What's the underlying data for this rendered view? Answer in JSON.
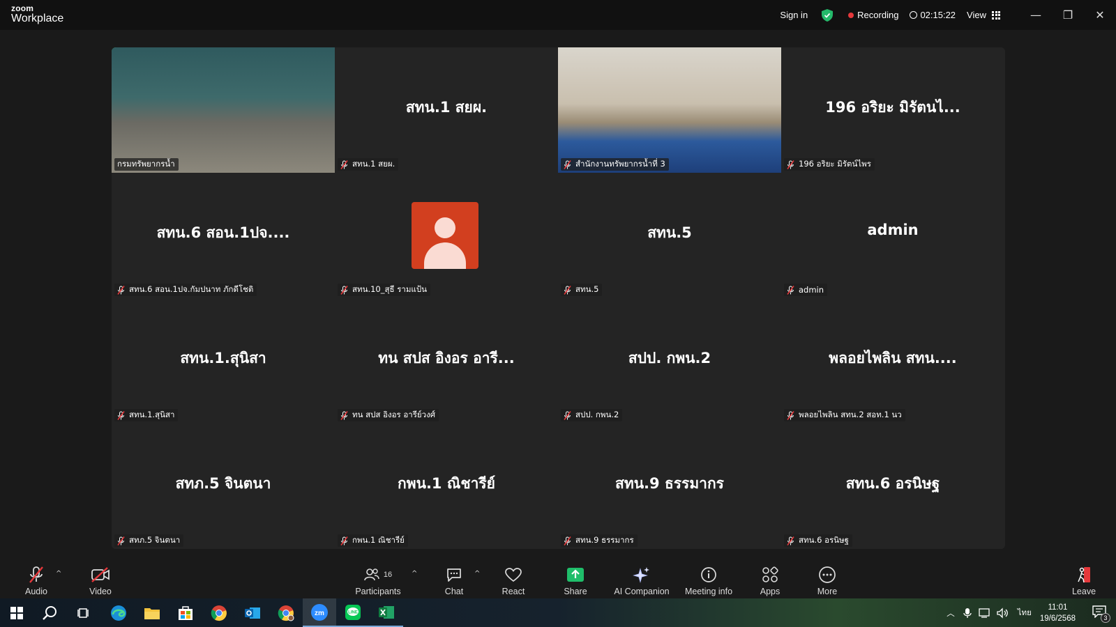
{
  "app": {
    "brand_small": "zoom",
    "brand_large": "Workplace"
  },
  "titlebar": {
    "sign_in": "Sign in",
    "recording": "Recording",
    "timer": "02:15:22",
    "view": "View"
  },
  "colors": {
    "active_speaker": "#3cd07a",
    "recording": "#e5383b",
    "avatar": "#d23f1f",
    "share": "#1fbe6a"
  },
  "tiles": [
    {
      "kind": "video",
      "big": "",
      "label": "กรมทรัพยากรน้ำ",
      "muted": false
    },
    {
      "kind": "name",
      "big": "สทน.1 สยผ.",
      "label": "สทน.1 สยผ.",
      "muted": true
    },
    {
      "kind": "video",
      "big": "",
      "label": "สำนักงานทรัพยากรน้ำที่ 3",
      "muted": true
    },
    {
      "kind": "name",
      "big": "196 อริยะ มิรัตนไ...",
      "label": "196 อริยะ มิรัตน์ไพร",
      "muted": true
    },
    {
      "kind": "name",
      "big": "สทน.6 สอน.1ปจ....",
      "label": "สทน.6 สอน.1ปจ.กัมปนาท ภักดีโชติ",
      "muted": true
    },
    {
      "kind": "avatar",
      "big": "",
      "label": "สทน.10_สุธี รามแป้น",
      "muted": true
    },
    {
      "kind": "name",
      "big": "สทน.5",
      "label": "สทน.5",
      "muted": true
    },
    {
      "kind": "name",
      "big": "admin",
      "label": "admin",
      "muted": true
    },
    {
      "kind": "name",
      "big": "สทน.1.สุนิสา",
      "label": "สทน.1.สุนิสา",
      "muted": true
    },
    {
      "kind": "name",
      "big": "ทน สปส อิงอร อารี...",
      "label": "ทน สปส อิงอร อารีย์วงศ์",
      "muted": true
    },
    {
      "kind": "name",
      "big": "สปป. กพน.2",
      "label": "สปป. กพน.2",
      "muted": true
    },
    {
      "kind": "name",
      "big": "พลอยไพลิน สทน....",
      "label": "พลอยไพลิน สทน.2 สอท.1 นว",
      "muted": true
    },
    {
      "kind": "name",
      "big": "สทภ.5 จินตนา",
      "label": "สทภ.5 จินตนา",
      "muted": true
    },
    {
      "kind": "name",
      "big": "กพน.1 ณิชารีย์",
      "label": "กพน.1 ณิชารีย์",
      "muted": true
    },
    {
      "kind": "name",
      "big": "สทน.9 ธรรมากร",
      "label": "สทน.9 ธรรมากร",
      "muted": true
    },
    {
      "kind": "name",
      "big": "สทน.6 อรนิษฐ",
      "label": "สทน.6 อรนิษฐ",
      "muted": true
    }
  ],
  "controls": {
    "audio": "Audio",
    "video": "Video",
    "participants": "Participants",
    "participants_count": "16",
    "chat": "Chat",
    "react": "React",
    "share": "Share",
    "ai": "AI Companion",
    "info": "Meeting info",
    "apps": "Apps",
    "more": "More",
    "leave": "Leave"
  },
  "taskbar": {
    "lang": "ไทย",
    "time": "11:01",
    "date": "19/6/2568",
    "notif_count": "3"
  }
}
